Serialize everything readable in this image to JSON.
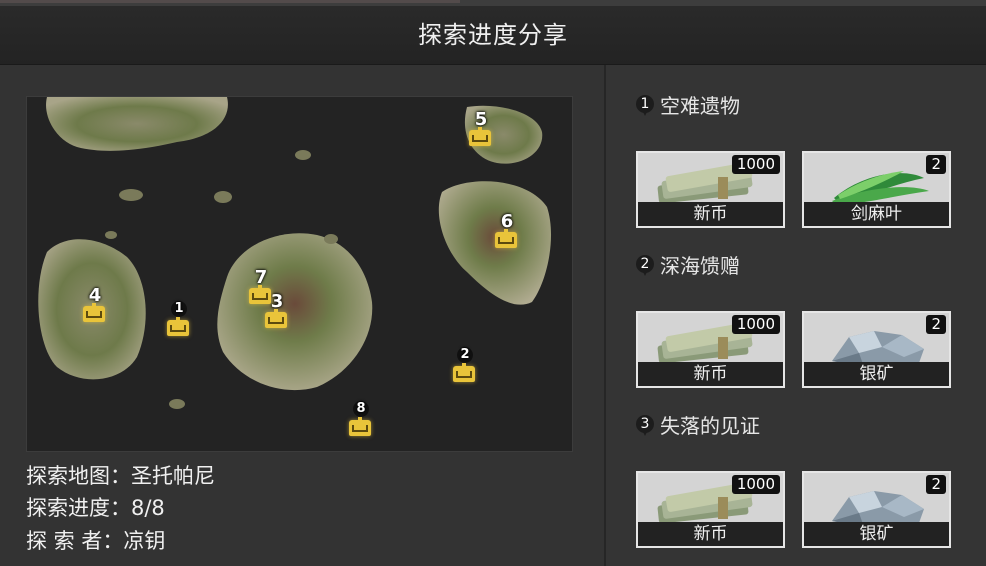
{
  "title": "探索进度分享",
  "map_markers": [
    {
      "num": "1",
      "style": "dark"
    },
    {
      "num": "2",
      "style": "dark"
    },
    {
      "num": "3",
      "style": "plain"
    },
    {
      "num": "4",
      "style": "plain"
    },
    {
      "num": "5",
      "style": "plain"
    },
    {
      "num": "6",
      "style": "plain"
    },
    {
      "num": "7",
      "style": "plain"
    },
    {
      "num": "8",
      "style": "dark"
    }
  ],
  "info": {
    "map_line": "探索地图：圣托帕尼",
    "progress_line": "探索进度：8/8",
    "explorer_line": "探 索 者：凉钥"
  },
  "rewards": [
    {
      "num": "1",
      "title": "空难遗物",
      "items": [
        {
          "name": "新币",
          "qty": "1000",
          "icon": "banknotes-icon"
        },
        {
          "name": "剑麻叶",
          "qty": "2",
          "icon": "sisal-leaf-icon"
        }
      ]
    },
    {
      "num": "2",
      "title": "深海馈赠",
      "items": [
        {
          "name": "新币",
          "qty": "1000",
          "icon": "banknotes-icon"
        },
        {
          "name": "银矿",
          "qty": "2",
          "icon": "silver-ore-icon"
        }
      ]
    },
    {
      "num": "3",
      "title": "失落的见证",
      "items": [
        {
          "name": "新币",
          "qty": "1000",
          "icon": "banknotes-icon"
        },
        {
          "name": "银矿",
          "qty": "2",
          "icon": "silver-ore-icon"
        }
      ]
    }
  ]
}
